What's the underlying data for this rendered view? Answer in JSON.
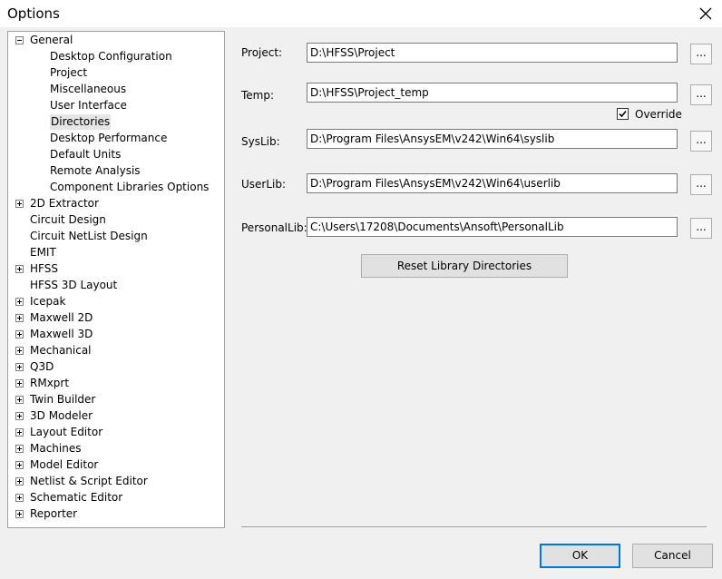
{
  "window": {
    "title": "Options"
  },
  "tree": {
    "items": [
      {
        "label": "General",
        "expander": "minus"
      },
      {
        "label": "Desktop Configuration"
      },
      {
        "label": "Project"
      },
      {
        "label": "Miscellaneous"
      },
      {
        "label": "User Interface"
      },
      {
        "label": "Directories",
        "selected": true
      },
      {
        "label": "Desktop Performance"
      },
      {
        "label": "Default Units"
      },
      {
        "label": "Remote Analysis"
      },
      {
        "label": "Component Libraries Options"
      },
      {
        "label": "2D Extractor",
        "expander": "plus"
      },
      {
        "label": "Circuit Design"
      },
      {
        "label": "Circuit NetList Design"
      },
      {
        "label": "EMIT"
      },
      {
        "label": "HFSS",
        "expander": "plus"
      },
      {
        "label": "HFSS 3D Layout"
      },
      {
        "label": "Icepak",
        "expander": "plus"
      },
      {
        "label": "Maxwell 2D",
        "expander": "plus"
      },
      {
        "label": "Maxwell 3D",
        "expander": "plus"
      },
      {
        "label": "Mechanical",
        "expander": "plus"
      },
      {
        "label": "Q3D",
        "expander": "plus"
      },
      {
        "label": "RMxprt",
        "expander": "plus"
      },
      {
        "label": "Twin Builder",
        "expander": "plus"
      },
      {
        "label": "3D Modeler",
        "expander": "plus"
      },
      {
        "label": "Layout Editor",
        "expander": "plus"
      },
      {
        "label": "Machines",
        "expander": "plus"
      },
      {
        "label": "Model Editor",
        "expander": "plus"
      },
      {
        "label": "Netlist & Script Editor",
        "expander": "plus"
      },
      {
        "label": "Schematic Editor",
        "expander": "plus"
      },
      {
        "label": "Reporter",
        "expander": "plus"
      }
    ]
  },
  "directories": {
    "project": {
      "label": "Project:",
      "value": "D:\\HFSS\\Project"
    },
    "temp": {
      "label": "Temp:",
      "value": "D:\\HFSS\\Project_temp"
    },
    "override": {
      "label": "Override",
      "checked": true
    },
    "syslib": {
      "label": "SysLib:",
      "value": "D:\\Program Files\\AnsysEM\\v242\\Win64\\syslib"
    },
    "userlib": {
      "label": "UserLib:",
      "value": "D:\\Program Files\\AnsysEM\\v242\\Win64\\userlib"
    },
    "personallib": {
      "label": "PersonalLib:",
      "value": "C:\\Users\\17208\\Documents\\Ansoft\\PersonalLib"
    },
    "browse_label": "...",
    "reset_label": "Reset Library Directories"
  },
  "footer": {
    "ok_label": "OK",
    "cancel_label": "Cancel"
  }
}
